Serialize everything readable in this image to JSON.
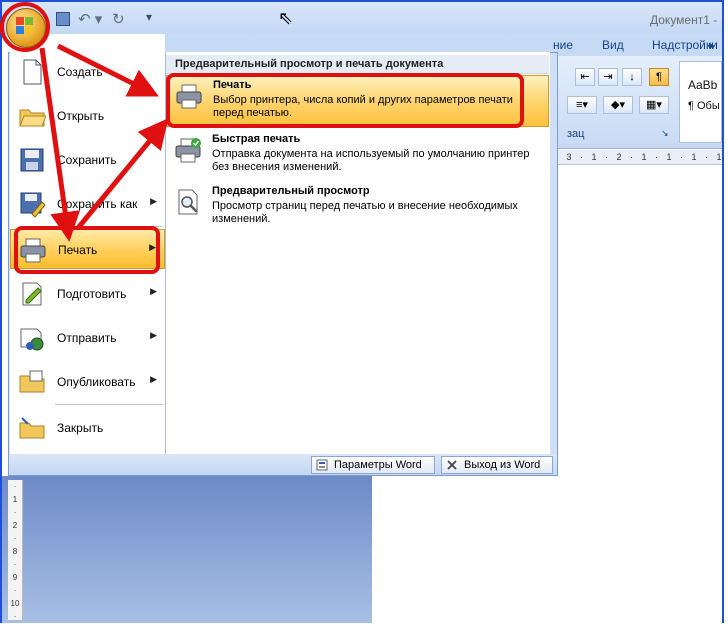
{
  "window": {
    "doc_title": "Документ1 -"
  },
  "ribbon": {
    "tabs": [
      "ние",
      "Вид",
      "Надстройки"
    ],
    "group_label": "зац",
    "styles_preview_1": "AaBb",
    "styles_preview_2": "¶ Обы"
  },
  "office_menu": {
    "items": [
      {
        "label": "Создать",
        "icon": "new-document-icon",
        "has_submenu": false
      },
      {
        "label": "Открыть",
        "icon": "open-folder-icon",
        "has_submenu": false
      },
      {
        "label": "Сохранить",
        "icon": "save-disk-icon",
        "has_submenu": false
      },
      {
        "label": "Сохранить как",
        "icon": "save-as-icon",
        "has_submenu": true
      },
      {
        "label": "Печать",
        "icon": "printer-icon",
        "has_submenu": true,
        "highlighted": true
      },
      {
        "label": "Подготовить",
        "icon": "prepare-icon",
        "has_submenu": true
      },
      {
        "label": "Отправить",
        "icon": "send-icon",
        "has_submenu": true
      },
      {
        "label": "Опубликовать",
        "icon": "publish-icon",
        "has_submenu": true
      },
      {
        "label": "Закрыть",
        "icon": "close-folder-icon",
        "has_submenu": false
      }
    ],
    "submenu": {
      "header": "Предварительный просмотр и печать документа",
      "options": [
        {
          "title": "Печать",
          "description": "Выбор принтера, числа копий и других параметров печати перед печатью.",
          "icon": "printer-icon",
          "highlighted": true
        },
        {
          "title": "Быстрая печать",
          "description": "Отправка документа на используемый по умолчанию принтер без внесения изменений.",
          "icon": "quick-print-icon"
        },
        {
          "title": "Предварительный просмотр",
          "description": "Просмотр страниц перед печатью и внесение необходимых изменений.",
          "icon": "print-preview-icon"
        }
      ]
    },
    "footer": {
      "options_label": "Параметры Word",
      "exit_label": "Выход из Word"
    }
  },
  "colors": {
    "annotation_red": "#e01010",
    "highlight": "#ffcf5a",
    "frame_blue": "#1d4fd8"
  }
}
